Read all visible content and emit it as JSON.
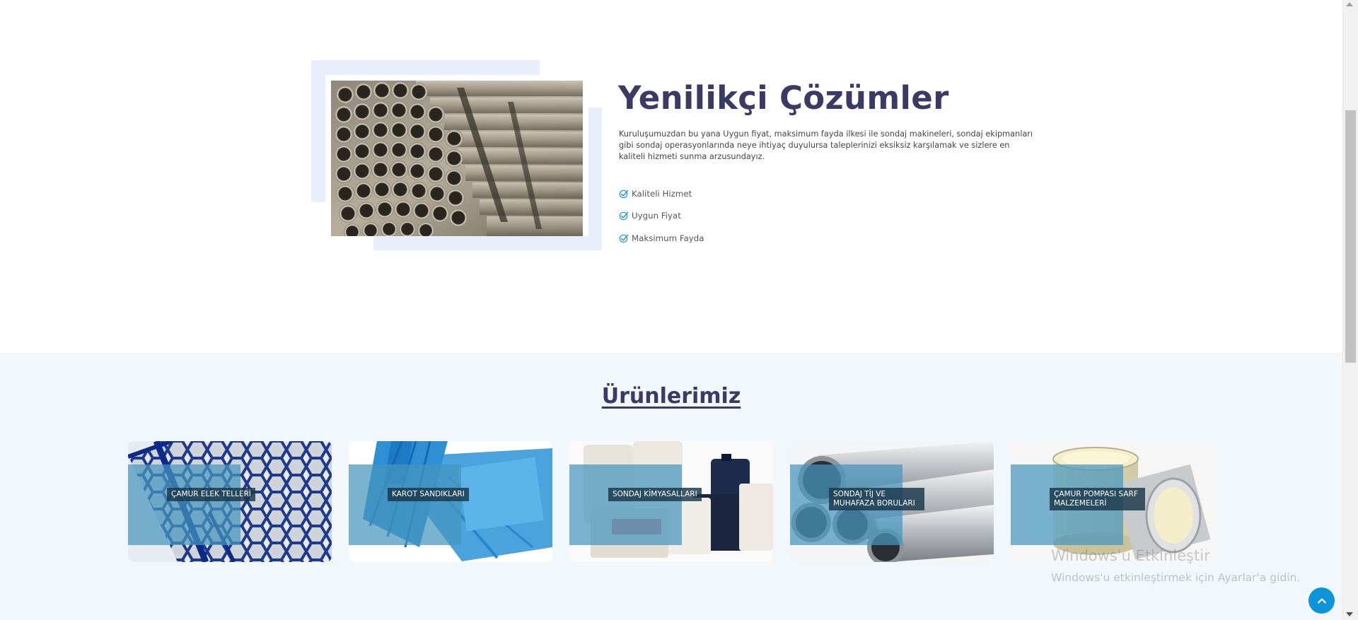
{
  "about": {
    "title": "Yenilikçi Çözümler",
    "description": "Kuruluşumuzdan bu yana Uygun fiyat, maksimum fayda ilkesi ile sondaj makineleri, sondaj ekipmanları gibi sondaj operasyonlarında neye ihtiyaç duyulursa taleplerinizi eksiksiz karşılamak ve sizlere en kaliteli hizmeti sunma arzusundayız.",
    "features": [
      {
        "label": " Kaliteli Hizmet",
        "icon": "check-circle-icon"
      },
      {
        "label": "Uygun Fiyat",
        "icon": "check-circle-icon"
      },
      {
        "label": "Maksimum Fayda",
        "icon": "check-circle-icon"
      }
    ],
    "image": "steel-pipes-bundle"
  },
  "products": {
    "title": "Ürünlerimiz",
    "items": [
      {
        "label": "ÇAMUR ELEK TELLERİ",
        "image": "shaker-screen"
      },
      {
        "label": "KAROT SANDIKLARI",
        "image": "core-boxes"
      },
      {
        "label": "SONDAJ KİMYASALLARI",
        "image": "chemical-bags"
      },
      {
        "label": "SONDAJ TİJ VE MUHAFAZA BORULARI",
        "image": "casing-pipes"
      },
      {
        "label": "ÇAMUR POMPASI SARF MALZEMELERİ",
        "image": "pump-liner"
      }
    ]
  },
  "watermark": {
    "title": "Windows'u Etkinleştir",
    "subtitle": "Windows'u etkinleştirmek için Ayarlar'a gidin."
  },
  "scroll_top": {
    "icon": "chevron-up-icon"
  },
  "colors": {
    "heading": "#3b3a65",
    "accent": "#0e95d9",
    "overlay": "#4696be",
    "frame": "#e8eefb",
    "section_bg": "#f2f7fc"
  }
}
